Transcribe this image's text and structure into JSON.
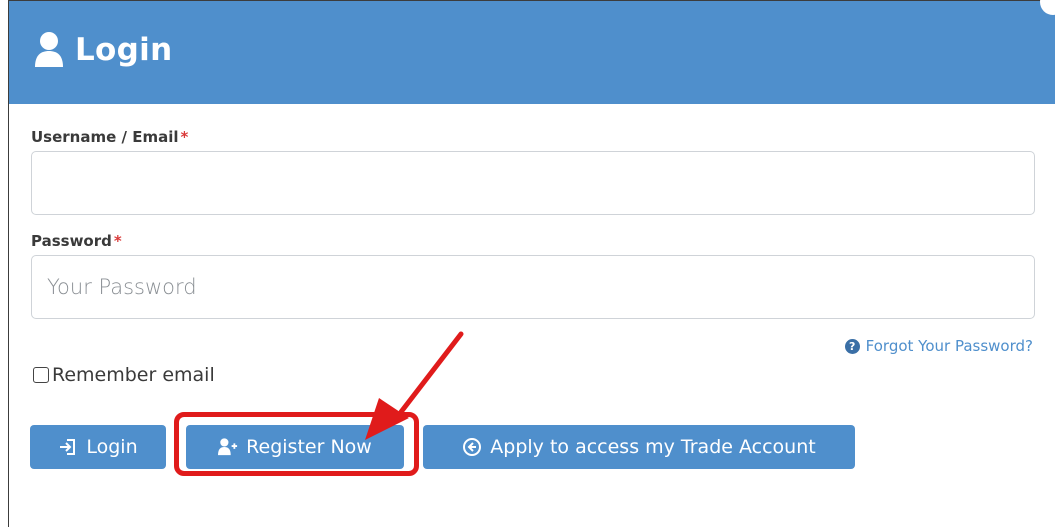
{
  "header": {
    "title": "Login",
    "color": "#4f8fcc",
    "icon": "user-icon"
  },
  "form": {
    "username_label": "Username / Email",
    "username_value": "",
    "username_placeholder": "",
    "password_label": "Password",
    "password_placeholder": "Your Password",
    "required_mark": "*",
    "forgot_password": "Forgot Your Password?",
    "remember_label": "Remember email",
    "remember_checked": false
  },
  "buttons": {
    "login": "Login",
    "register": "Register Now",
    "apply": "Apply to access my Trade Account"
  },
  "annotation": {
    "highlight_color": "#e01b1b",
    "arrow_color": "#e01b1b"
  }
}
